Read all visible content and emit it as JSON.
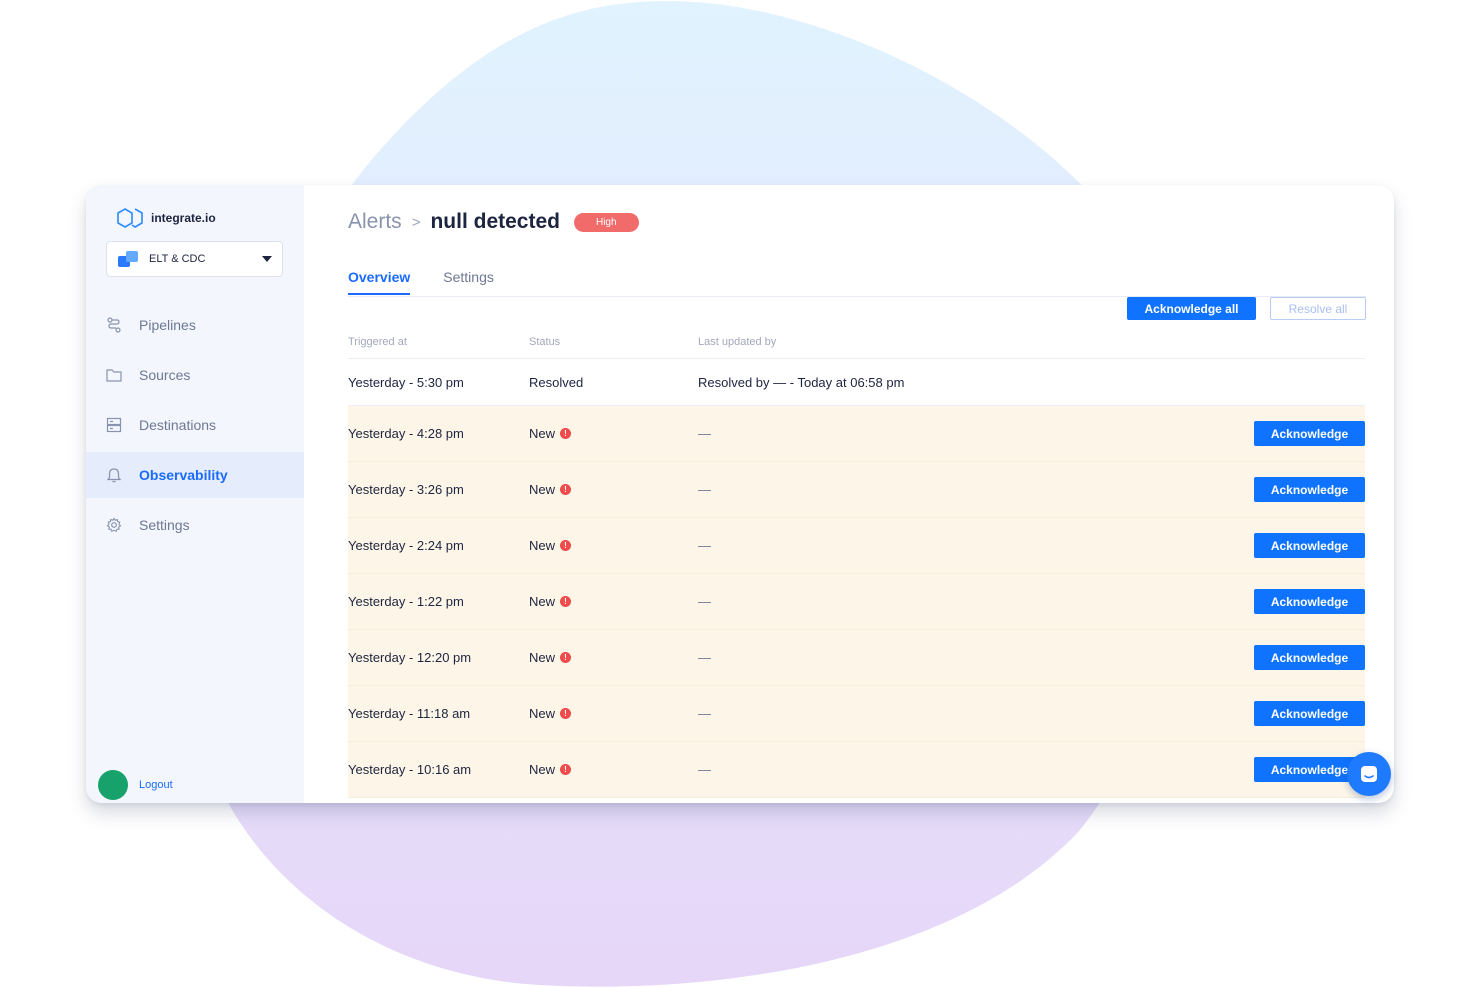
{
  "brand": {
    "name": "integrate.io"
  },
  "workspace": {
    "label": "ELT & CDC"
  },
  "sidebar": {
    "items": [
      {
        "label": "Pipelines",
        "icon": "pipelines-icon",
        "active": false
      },
      {
        "label": "Sources",
        "icon": "folder-icon",
        "active": false
      },
      {
        "label": "Destinations",
        "icon": "server-icon",
        "active": false
      },
      {
        "label": "Observability",
        "icon": "bell-icon",
        "active": true
      },
      {
        "label": "Settings",
        "icon": "gear-icon",
        "active": false
      }
    ],
    "logout_label": "Logout"
  },
  "header": {
    "breadcrumb_parent": "Alerts",
    "breadcrumb_sep": ">",
    "title": "null detected",
    "severity": "High"
  },
  "tabs": [
    {
      "label": "Overview",
      "active": true
    },
    {
      "label": "Settings",
      "active": false
    }
  ],
  "actions": {
    "acknowledge_all": "Acknowledge all",
    "resolve_all": "Resolve all"
  },
  "table": {
    "columns": [
      "Triggered at",
      "Status",
      "Last updated by"
    ],
    "rows": [
      {
        "triggered": "Yesterday - 5:30 pm",
        "status": "Resolved",
        "updated": "Resolved by — - Today at 06:58 pm"
      },
      {
        "triggered": "Yesterday - 4:28 pm",
        "status": "New",
        "updated": "—",
        "action": "Acknowledge"
      },
      {
        "triggered": "Yesterday - 3:26 pm",
        "status": "New",
        "updated": "—",
        "action": "Acknowledge"
      },
      {
        "triggered": "Yesterday - 2:24 pm",
        "status": "New",
        "updated": "—",
        "action": "Acknowledge"
      },
      {
        "triggered": "Yesterday - 1:22 pm",
        "status": "New",
        "updated": "—",
        "action": "Acknowledge"
      },
      {
        "triggered": "Yesterday - 12:20 pm",
        "status": "New",
        "updated": "—",
        "action": "Acknowledge"
      },
      {
        "triggered": "Yesterday - 11:18 am",
        "status": "New",
        "updated": "—",
        "action": "Acknowledge"
      },
      {
        "triggered": "Yesterday - 10:16 am",
        "status": "New",
        "updated": "—",
        "action": "Acknowledge"
      }
    ]
  },
  "colors": {
    "accent": "#0f73ff",
    "danger": "#f26b6b",
    "row_highlight": "#fdf6e8",
    "sidebar_bg": "#f3f6fd",
    "avatar": "#16a26a"
  }
}
